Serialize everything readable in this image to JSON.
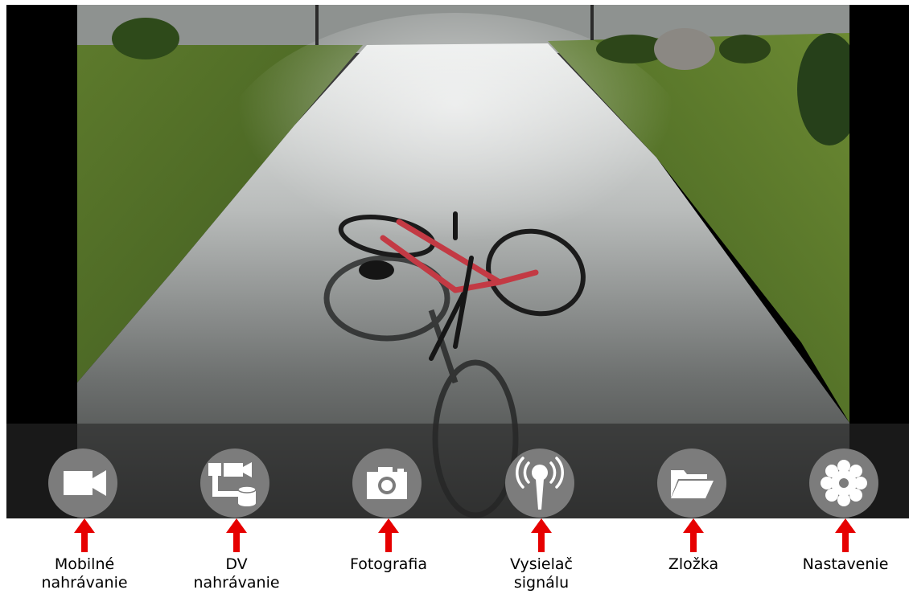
{
  "scene": {
    "subject": "bicycle-on-driveway"
  },
  "toolbar": {
    "buttons": [
      {
        "id": "mobile-record",
        "icon": "video-camera-icon",
        "label": "Mobilné\nnahrávanie"
      },
      {
        "id": "dv-record",
        "icon": "camera-to-storage-icon",
        "label": "DV\nnahrávanie"
      },
      {
        "id": "photo",
        "icon": "photo-camera-icon",
        "label": "Fotografia"
      },
      {
        "id": "transmitter",
        "icon": "signal-transmitter-icon",
        "label": "Vysielač\nsignálu"
      },
      {
        "id": "folder",
        "icon": "folder-icon",
        "label": "Zložka"
      },
      {
        "id": "settings",
        "icon": "gear-icon",
        "label": "Nastavenie"
      }
    ]
  },
  "colors": {
    "button_fill": "#7c7c7c",
    "icon_fill": "#ffffff",
    "arrow": "#e60000",
    "frame": "#000000"
  }
}
